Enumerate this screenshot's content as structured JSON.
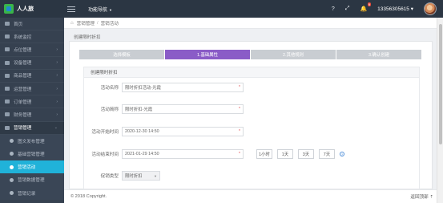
{
  "header": {
    "brand": "人人旅",
    "func_nav": "功能导航",
    "user": "13356305615",
    "notify_count": "9",
    "icons": {
      "help": "question-icon",
      "fullscreen": "expand-icon",
      "bell": "bell-icon"
    }
  },
  "sidebar": {
    "items": [
      {
        "label": "首页",
        "icon": "home-icon",
        "arrow": ""
      },
      {
        "label": "系统监控",
        "icon": "monitor-icon",
        "arrow": ""
      },
      {
        "label": "点位管理",
        "icon": "pin-icon",
        "arrow": "›"
      },
      {
        "label": "设备管理",
        "icon": "device-icon",
        "arrow": "›"
      },
      {
        "label": "商品管理",
        "icon": "goods-icon",
        "arrow": "›"
      },
      {
        "label": "运营管理",
        "icon": "ops-icon",
        "arrow": "›"
      },
      {
        "label": "订单管理",
        "icon": "order-icon",
        "arrow": "›"
      },
      {
        "label": "财务管理",
        "icon": "finance-icon",
        "arrow": "›"
      },
      {
        "label": "营销管理",
        "icon": "marketing-icon",
        "arrow": "⌄"
      }
    ],
    "subitems": [
      {
        "label": "图文发布管理",
        "active": false
      },
      {
        "label": "基础营销管理",
        "active": false
      },
      {
        "label": "营销活动",
        "active": true
      },
      {
        "label": "营销数据管理",
        "active": false
      },
      {
        "label": "营销记录",
        "active": false
      }
    ]
  },
  "breadcrumb": {
    "home": "⌂",
    "items": [
      "营销管理",
      "营销活动"
    ]
  },
  "page_title": "创建限时折扣",
  "steps": [
    {
      "label": "选择模板",
      "active": false
    },
    {
      "label": "1.基础属性",
      "active": true
    },
    {
      "label": "2.其他规则",
      "active": false
    },
    {
      "label": "3.确认创建",
      "active": false
    }
  ],
  "form": {
    "heading": "创建限时折扣",
    "fields": [
      {
        "label": "活动名称",
        "value": "限时折扣活动-光霞",
        "required": true,
        "type": "text"
      },
      {
        "label": "活动简称",
        "value": "限时折扣-光霞",
        "required": true,
        "type": "text"
      },
      {
        "label": "活动开始时间",
        "value": "2020-12-30 14:50",
        "required": true,
        "type": "text"
      },
      {
        "label": "活动结束时间",
        "value": "2021-01-29 14:50",
        "required": true,
        "type": "text",
        "quick": [
          "1小时",
          "1天",
          "3天",
          "7天"
        ]
      },
      {
        "label": "促销类型",
        "value": "限时折扣",
        "required": false,
        "type": "select"
      }
    ]
  },
  "footer": {
    "copyright": "© 2018 Copyright.",
    "back": "返回顶部"
  }
}
